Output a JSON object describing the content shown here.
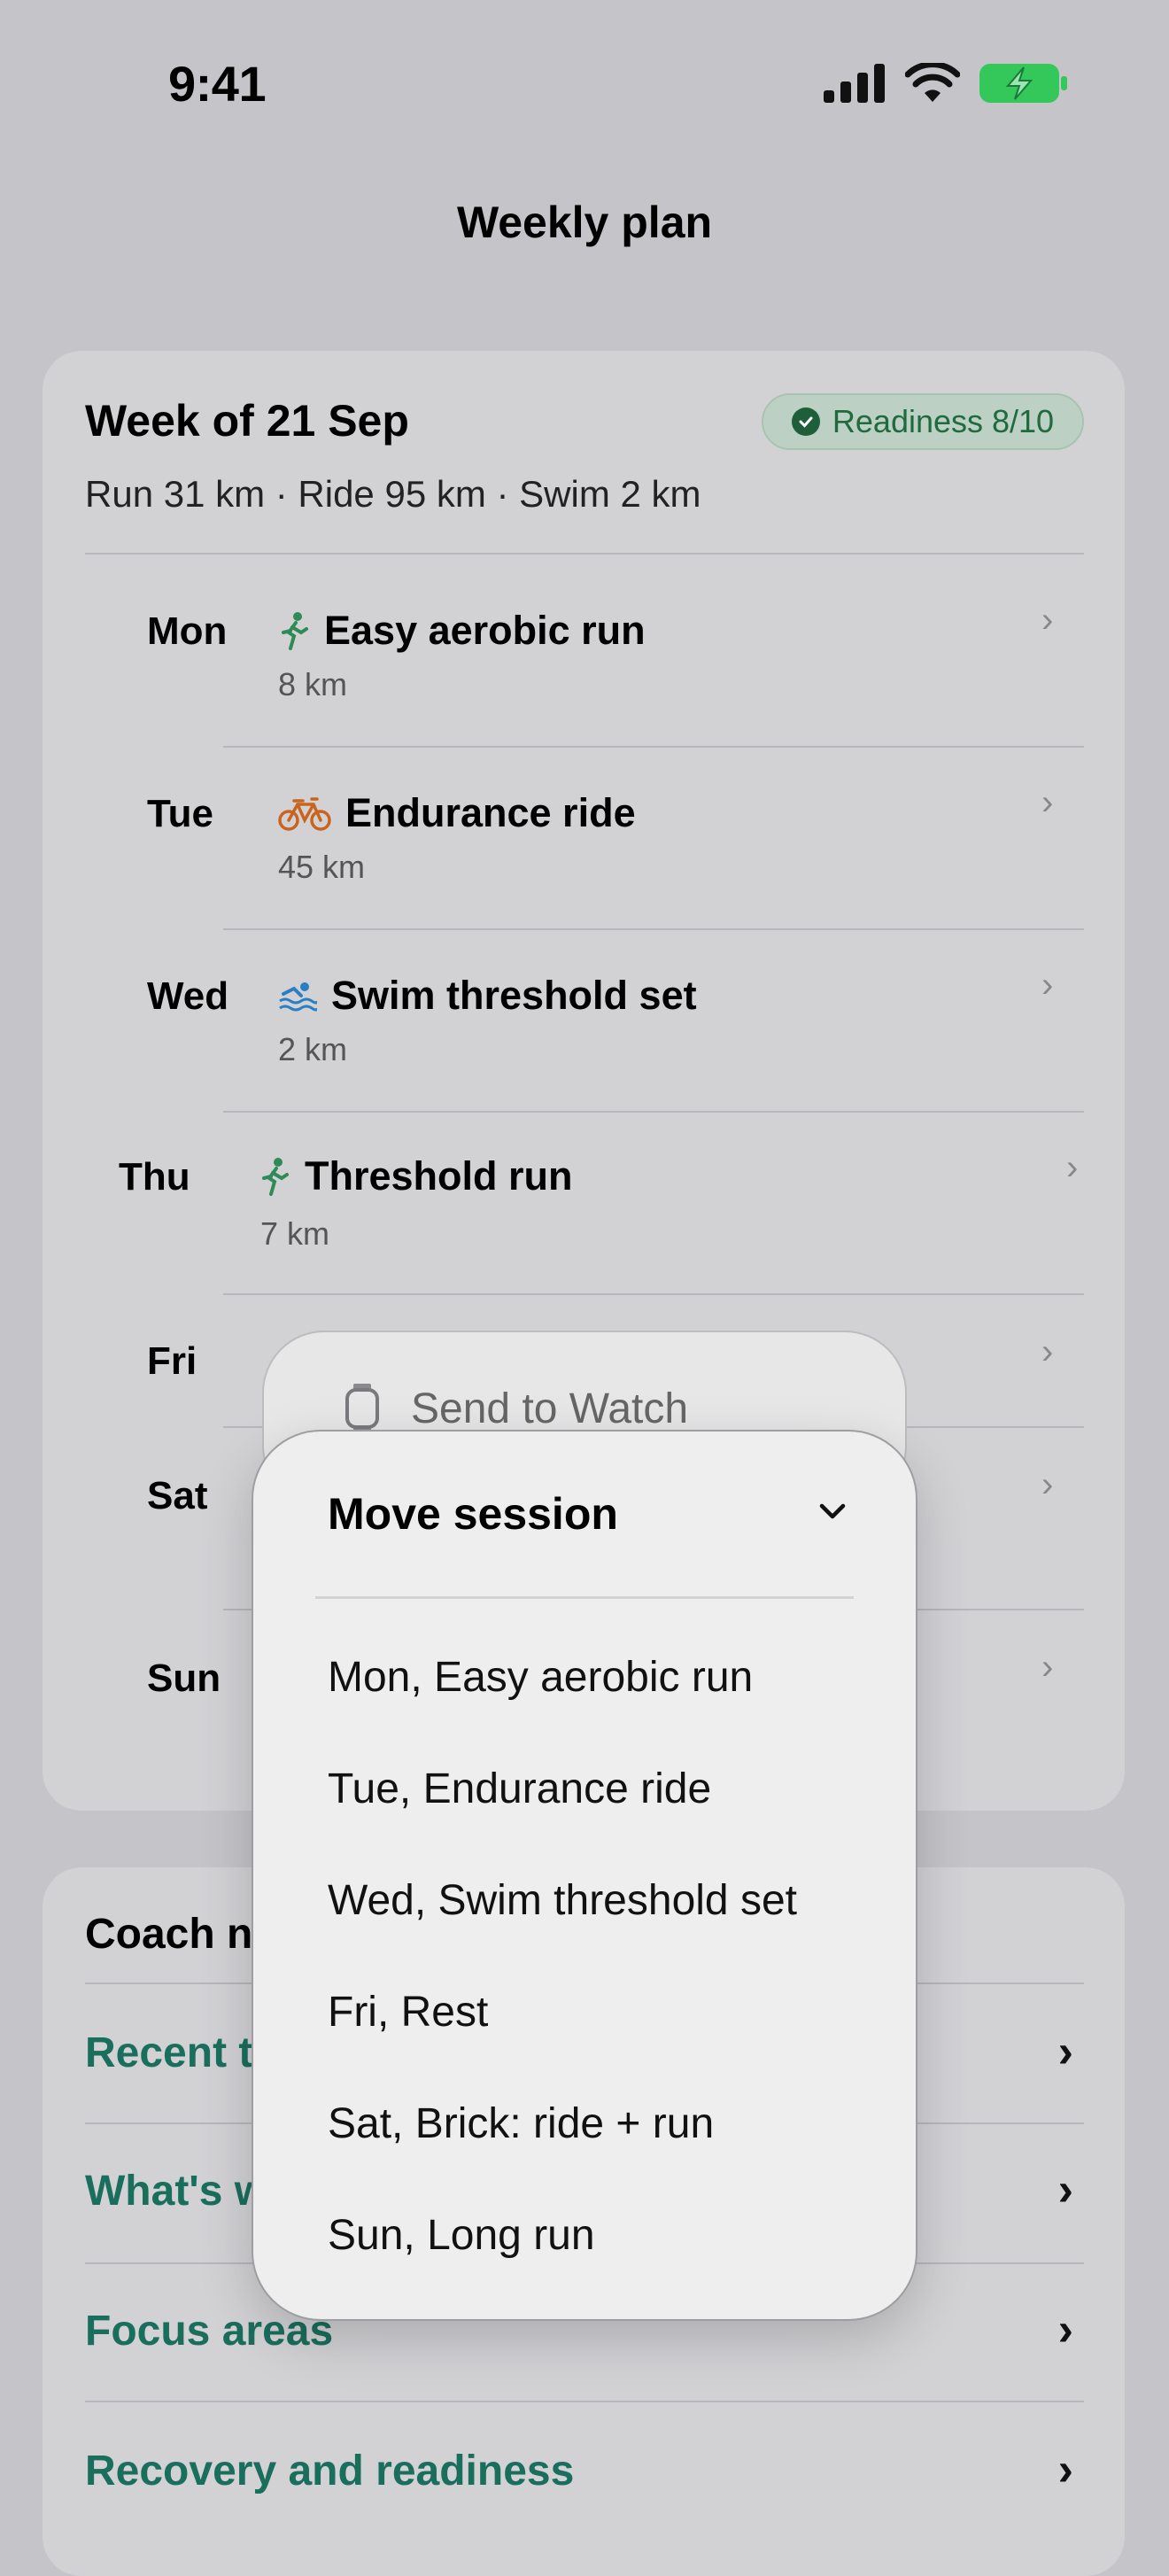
{
  "status_bar": {
    "time": "9:41",
    "icons": [
      "cellular-signal-icon",
      "wifi-icon",
      "battery-charging-icon"
    ],
    "battery_color": "#34c759"
  },
  "nav": {
    "title": "Weekly plan"
  },
  "week": {
    "title": "Week of 21 Sep",
    "summary": "Run 31 km · Ride 95 km · Swim 2 km",
    "readiness": "Readiness 8/10",
    "days": [
      {
        "day": "Mon",
        "icon": "run-icon",
        "name": "Easy aerobic run",
        "distance": "8 km"
      },
      {
        "day": "Tue",
        "icon": "bike-icon",
        "name": "Endurance ride",
        "distance": "45 km"
      },
      {
        "day": "Wed",
        "icon": "swim-icon",
        "name": "Swim threshold set",
        "distance": "2 km"
      },
      {
        "day": "Thu",
        "icon": "run-icon",
        "name": "Threshold run",
        "distance": "7 km"
      },
      {
        "day": "Fri"
      },
      {
        "day": "Sat"
      },
      {
        "day": "Sun"
      }
    ]
  },
  "coach": {
    "title": "Coach n",
    "links": [
      "Recent t",
      "What's w",
      "Focus areas",
      "Recovery and readiness"
    ]
  },
  "context_menu": {
    "send_to_watch": "Send to Watch",
    "header": "Move session",
    "items": [
      "Mon, Easy aerobic run",
      "Tue, Endurance ride",
      "Wed, Swim threshold set",
      "Fri, Rest",
      "Sat, Brick: ride + run",
      "Sun, Long run"
    ]
  },
  "colors": {
    "accent": "#1a6e5c",
    "readiness_text": "#1f6a3e",
    "run_icon": "#2e8b57",
    "bike_icon": "#c8641e",
    "swim_icon": "#2a7fc4"
  }
}
